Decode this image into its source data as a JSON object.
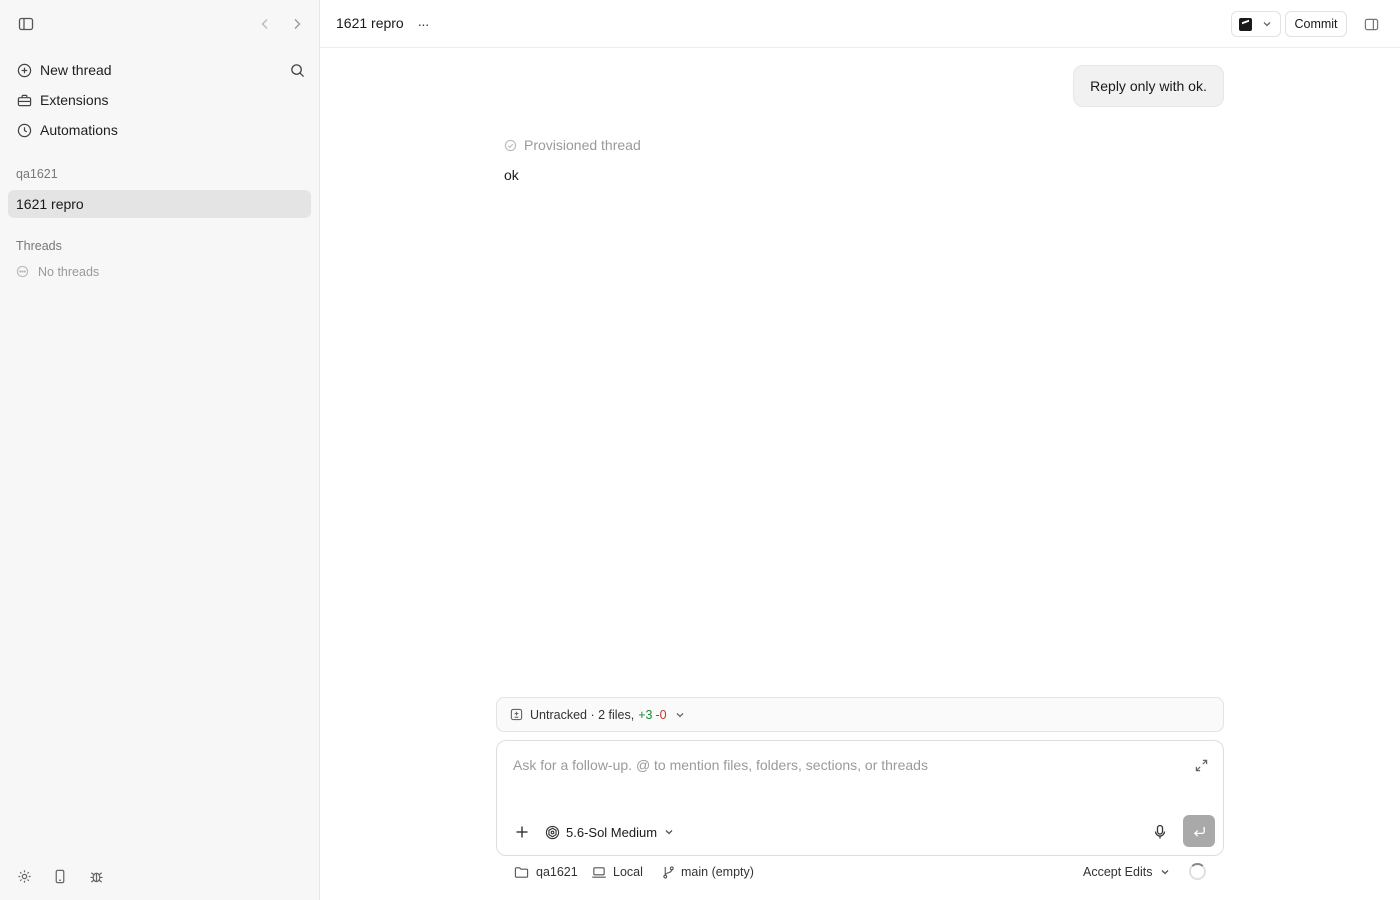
{
  "sidebar": {
    "nav": {
      "new_thread": "New thread",
      "extensions": "Extensions",
      "automations": "Automations"
    },
    "project_section": "qa1621",
    "active_project_item": "1621 repro",
    "threads_section": "Threads",
    "no_threads": "No threads"
  },
  "header": {
    "title": "1621 repro",
    "more": "···",
    "commit_label": "Commit"
  },
  "conversation": {
    "user_message": "Reply only with ok.",
    "provisioned_label": "Provisioned thread",
    "assistant_reply": "ok"
  },
  "composer": {
    "changes": {
      "prefix": "Untracked · 2 files,",
      "additions": "+3",
      "deletions": "-0"
    },
    "placeholder": "Ask for a follow-up. @ to mention files, folders, sections, or threads",
    "model_label": "5.6-Sol Medium"
  },
  "status_bar": {
    "folder": "qa1621",
    "location": "Local",
    "branch": "main (empty)",
    "mode": "Accept Edits"
  }
}
